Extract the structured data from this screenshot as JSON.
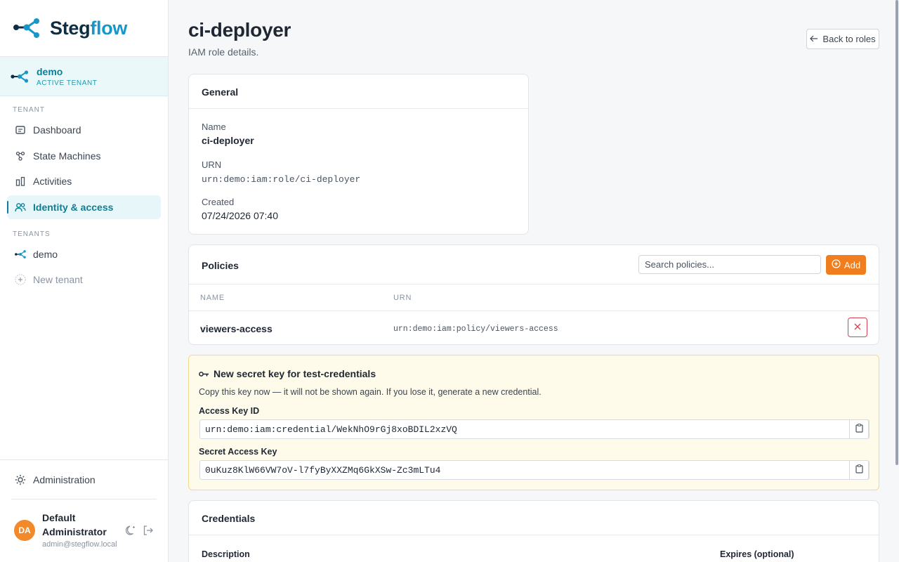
{
  "brand": {
    "part1": "Steg",
    "part2": "flow"
  },
  "active_tenant": {
    "name": "demo",
    "subtitle": "ACTIVE TENANT"
  },
  "sidebar": {
    "tenant_section": "TENANT",
    "items": [
      {
        "label": "Dashboard",
        "icon": "dashboard-icon"
      },
      {
        "label": "State Machines",
        "icon": "state-machine-icon"
      },
      {
        "label": "Activities",
        "icon": "activities-icon"
      },
      {
        "label": "Identity & access",
        "icon": "users-icon",
        "active": true
      }
    ],
    "tenants_section": "TENANTS",
    "tenants": [
      {
        "label": "demo"
      }
    ],
    "new_tenant": "New tenant",
    "administration": "Administration"
  },
  "user": {
    "initials": "DA",
    "name_line1": "Default",
    "name_line2": "Administrator",
    "email": "admin@stegflow.local"
  },
  "page": {
    "title": "ci-deployer",
    "subtitle": "IAM role details.",
    "back_label": "Back to roles"
  },
  "general": {
    "heading": "General",
    "name_label": "Name",
    "name_value": "ci-deployer",
    "urn_label": "URN",
    "urn_value": "urn:demo:iam:role/ci-deployer",
    "created_label": "Created",
    "created_value": "07/24/2026 07:40"
  },
  "policies": {
    "heading": "Policies",
    "search_placeholder": "Search policies...",
    "add_label": "Add",
    "columns": [
      "NAME",
      "URN"
    ],
    "rows": [
      {
        "name": "viewers-access",
        "urn": "urn:demo:iam:policy/viewers-access"
      }
    ]
  },
  "secret": {
    "title": "New secret key for test-credentials",
    "notice": "Copy this key now — it will not be shown again. If you lose it, generate a new credential.",
    "access_key_label": "Access Key ID",
    "access_key_value": "urn:demo:iam:credential/WekNhO9rGj8xoBDIL2xzVQ",
    "secret_key_label": "Secret Access Key",
    "secret_key_value": "0uKuz8KlW66VW7oV-l7fyByXXZMq6GkXSw-Zc3mLTu4"
  },
  "credentials": {
    "heading": "Credentials",
    "description_label": "Description",
    "expires_label": "Expires (optional)"
  },
  "colors": {
    "brand_dark": "#0d2d44",
    "brand_teal": "#1797c7",
    "accent_orange": "#f07d1e",
    "danger": "#d9434f"
  }
}
